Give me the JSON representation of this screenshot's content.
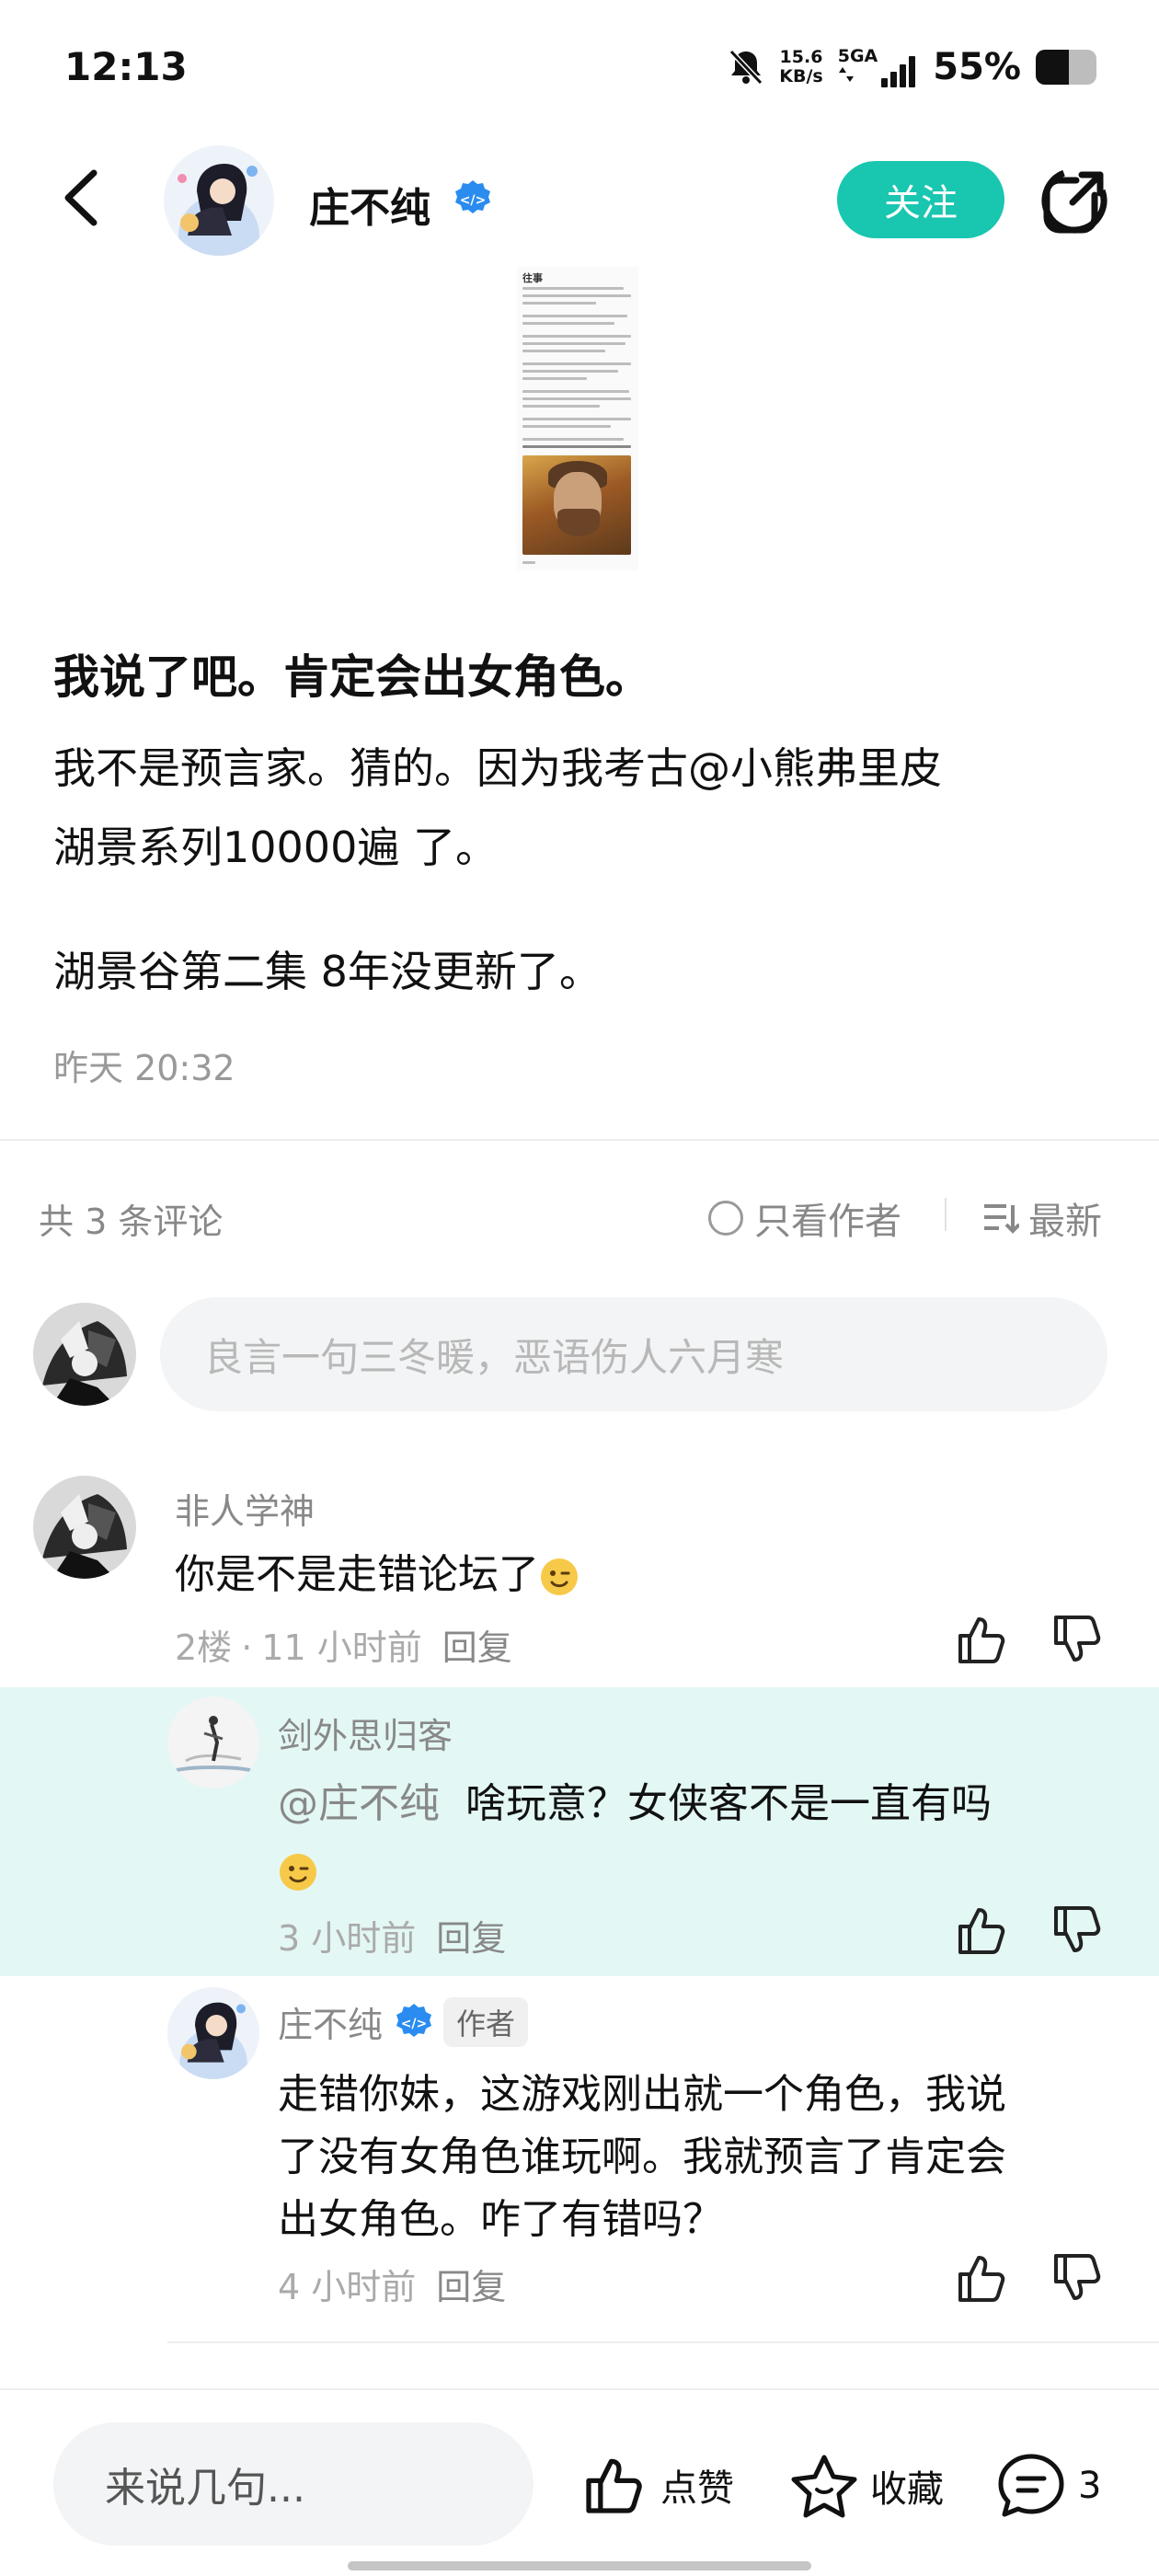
{
  "status_bar": {
    "time": "12:13",
    "net_speed_value": "15.6",
    "net_speed_unit": "KB/s",
    "network": "5GA",
    "battery_percent": "55%",
    "battery_level": 0.55
  },
  "header": {
    "author_name": "庄不纯",
    "follow_label": "关注",
    "icons": {
      "back": "back-arrow-icon",
      "share": "share-icon",
      "verify": "verified-badge-icon"
    }
  },
  "post": {
    "title": "我说了吧。肯定会出女角色。",
    "paragraph1_line1": "我不是预言家。猜的。因为我考古@小熊弗里皮",
    "paragraph1_line2": "湖景系列10000遍 了。",
    "paragraph2": "湖景谷第二集 8年没更新了。",
    "time": "昨天 20:32",
    "image_header": "往事"
  },
  "comments_header": {
    "count_label": "共 3 条评论",
    "author_only_label": "只看作者",
    "sort_label": "最新"
  },
  "comment_input": {
    "placeholder": "良言一句三冬暖，恶语伤人六月寒"
  },
  "comments": [
    {
      "name": "非人学神",
      "text": "你是不是走错论坛了",
      "floor": "2楼",
      "time": "11 小时前",
      "reply_label": "回复"
    }
  ],
  "replies": [
    {
      "name": "剑外思归客",
      "mention": "@庄不纯",
      "text": "啥玩意？女侠客不是一直有吗",
      "time": "3 小时前",
      "reply_label": "回复"
    },
    {
      "name": "庄不纯",
      "author_tag": "作者",
      "line1": "走错你妹，这游戏刚出就一个角色，我说",
      "line2": "了没有女角色谁玩啊。我就预言了肯定会",
      "line3": "出女角色。咋了有错吗？",
      "time": "4 小时前",
      "reply_label": "回复"
    }
  ],
  "bottom_bar": {
    "input_placeholder": "来说几句...",
    "like_label": "点赞",
    "favorite_label": "收藏",
    "comment_count": "3"
  },
  "colors": {
    "accent": "#19c6b0",
    "highlight_bg": "#e3f7f4",
    "verify_blue": "#2a8cf0"
  }
}
